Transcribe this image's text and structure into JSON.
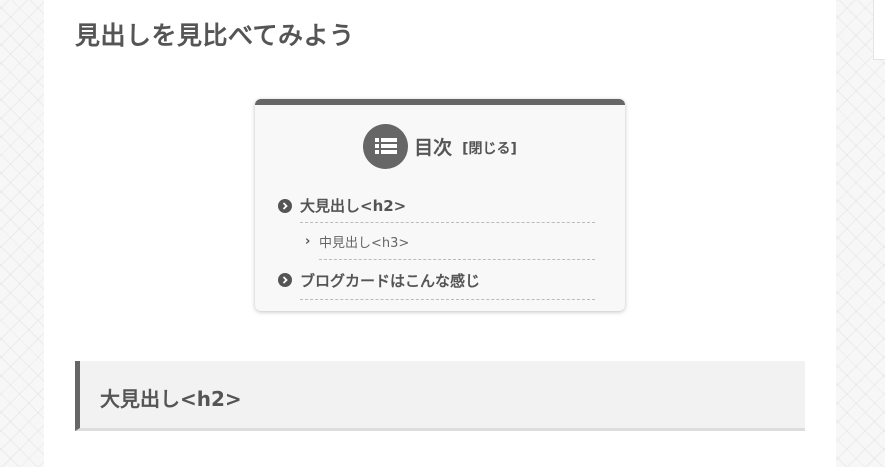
{
  "page": {
    "title": "見出しを見比べてみよう"
  },
  "toc": {
    "icon": "list-icon",
    "title": "目次",
    "toggle_label": "[閉じる]",
    "items": [
      {
        "level": 2,
        "label": "大見出し<h2>"
      },
      {
        "level": 3,
        "label": "中見出し<h3>"
      },
      {
        "level": 2,
        "label": "ブログカードはこんな感じ"
      }
    ]
  },
  "section": {
    "heading": "大見出し<h2>"
  },
  "colors": {
    "accent": "#666666",
    "text": "#555555",
    "heading_bg": "#f2f2f2",
    "toc_bg": "#f8f8f8"
  }
}
